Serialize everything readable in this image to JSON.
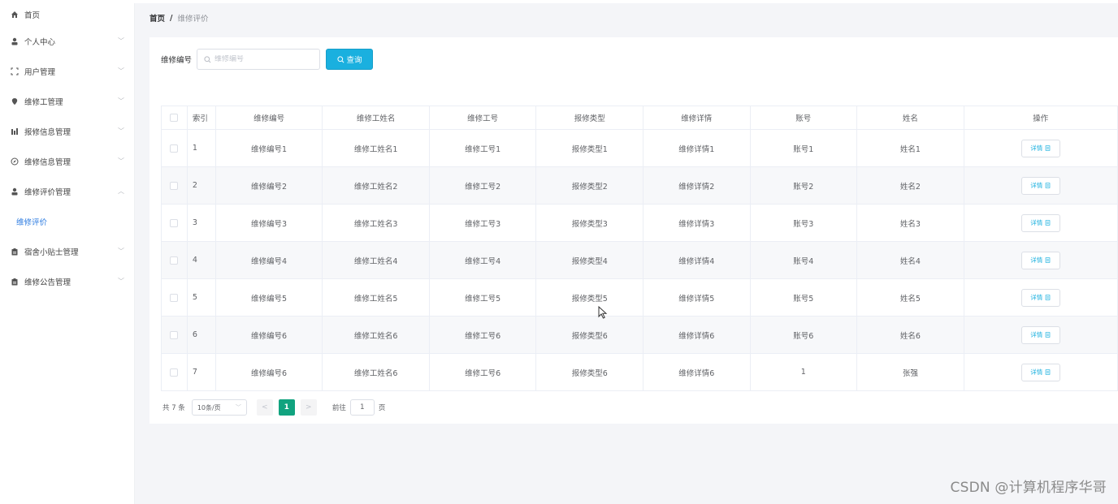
{
  "sidebar": {
    "home": {
      "label": "首页",
      "icon": "home-icon"
    },
    "items": [
      {
        "label": "个人中心",
        "icon": "person-icon",
        "arrow": "﹀"
      },
      {
        "label": "用户管理",
        "icon": "frame-icon",
        "arrow": "﹀"
      },
      {
        "label": "维修工管理",
        "icon": "location-pin-icon",
        "arrow": "﹀"
      },
      {
        "label": "报修信息管理",
        "icon": "chart-icon",
        "arrow": "﹀"
      },
      {
        "label": "维修信息管理",
        "icon": "compass-icon",
        "arrow": "﹀"
      },
      {
        "label": "维修评价管理",
        "icon": "person-icon",
        "arrow": "︿"
      },
      {
        "label": "维修评价",
        "icon": "",
        "arrow": ""
      },
      {
        "label": "宿舍小贴士管理",
        "icon": "clipboard-icon",
        "arrow": "﹀"
      },
      {
        "label": "维修公告管理",
        "icon": "clipboard-icon",
        "arrow": "﹀"
      }
    ]
  },
  "breadcrumb": {
    "home": "首页",
    "separator": "/",
    "current": "维修评价"
  },
  "search": {
    "label": "维修编号",
    "placeholder": "维修编号",
    "value": "",
    "button_label": "查询"
  },
  "table": {
    "headers": [
      "索引",
      "维修编号",
      "维修工姓名",
      "维修工号",
      "报修类型",
      "维修详情",
      "账号",
      "姓名",
      "操作"
    ],
    "rows": [
      [
        "1",
        "维修编号1",
        "维修工姓名1",
        "维修工号1",
        "报修类型1",
        "维修详情1",
        "账号1",
        "姓名1"
      ],
      [
        "2",
        "维修编号2",
        "维修工姓名2",
        "维修工号2",
        "报修类型2",
        "维修详情2",
        "账号2",
        "姓名2"
      ],
      [
        "3",
        "维修编号3",
        "维修工姓名3",
        "维修工号3",
        "报修类型3",
        "维修详情3",
        "账号3",
        "姓名3"
      ],
      [
        "4",
        "维修编号4",
        "维修工姓名4",
        "维修工号4",
        "报修类型4",
        "维修详情4",
        "账号4",
        "姓名4"
      ],
      [
        "5",
        "维修编号5",
        "维修工姓名5",
        "维修工号5",
        "报修类型5",
        "维修详情5",
        "账号5",
        "姓名5"
      ],
      [
        "6",
        "维修编号6",
        "维修工姓名6",
        "维修工号6",
        "报修类型6",
        "维修详情6",
        "账号6",
        "姓名6"
      ],
      [
        "7",
        "维修编号6",
        "维修工姓名6",
        "维修工号6",
        "报修类型6",
        "维修详情6",
        "1",
        "张强"
      ]
    ],
    "detail_label": "详情"
  },
  "pagination": {
    "total": "共 7 条",
    "page_size": "10条/页",
    "prev": "<",
    "current": "1",
    "next": ">",
    "goto_prefix": "前往",
    "goto_value": "1",
    "goto_suffix": "页"
  },
  "watermark": "CSDN @计算机程序华哥",
  "colors": {
    "accent": "#1ab0df",
    "pager_active": "#11a37f",
    "sub_menu_active": "#2f7de1"
  }
}
